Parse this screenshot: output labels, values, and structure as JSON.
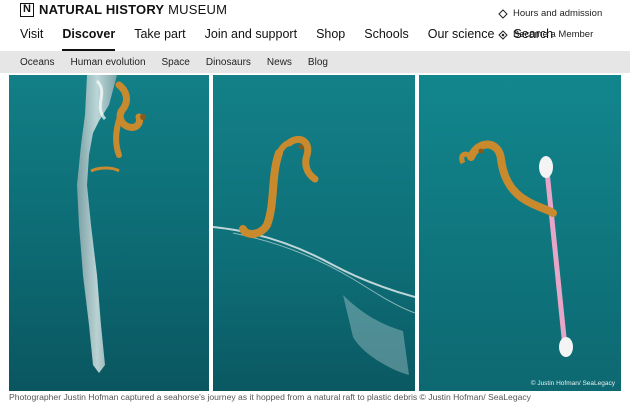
{
  "header": {
    "logo_bold": "NATURAL HISTORY",
    "logo_light": "MUSEUM",
    "utility": [
      {
        "label": "Hours and admission",
        "icon": "ticket-icon"
      },
      {
        "label": "Become a Member",
        "icon": "star-badge-icon"
      }
    ]
  },
  "main_nav": {
    "items": [
      "Visit",
      "Discover",
      "Take part",
      "Join and support",
      "Shop",
      "Schools",
      "Our science",
      "Search"
    ],
    "active": "Discover"
  },
  "sub_nav": {
    "items": [
      "Oceans",
      "Human evolution",
      "Space",
      "Dinosaurs",
      "News",
      "Blog"
    ]
  },
  "gallery": {
    "photo_credit": "© Justin Hofman/ SeaLegacy",
    "caption": "Photographer Justin Hofman captured a seahorse's journey as it hopped from a natural raft to plastic debris © Justin Hofman/ SeaLegacy",
    "colors": {
      "water_top": "#0f7b85",
      "water_bottom": "#0b5d66",
      "seahorse": "#c98a2e",
      "swab_stick": "#e7a6c8"
    }
  }
}
